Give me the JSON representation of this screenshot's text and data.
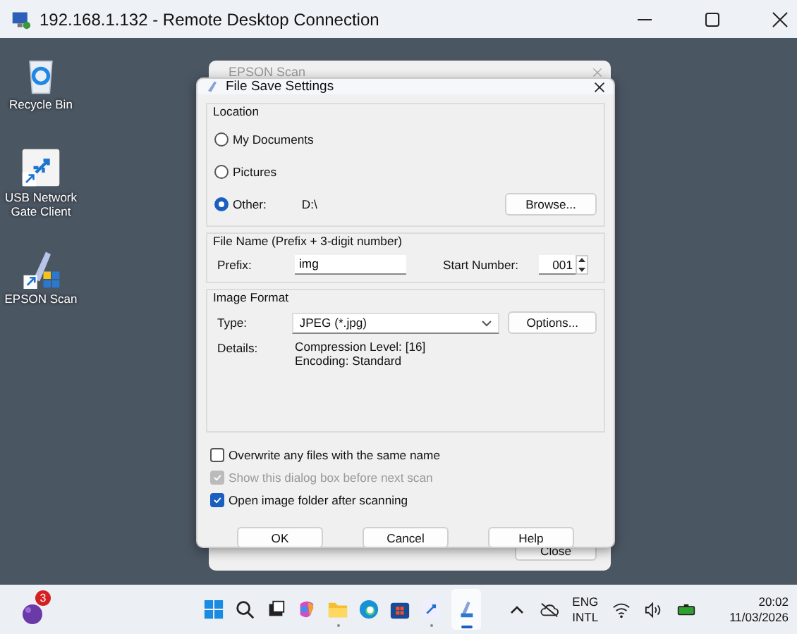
{
  "remote_window": {
    "title": "192.168.1.132 - Remote Desktop Connection"
  },
  "desktop_icons": [
    {
      "kind": "recycle",
      "label": "Recycle Bin"
    },
    {
      "kind": "usb",
      "label": "USB Network Gate Client"
    },
    {
      "kind": "scanner",
      "label": "EPSON Scan"
    }
  ],
  "background_window": {
    "title": "EPSON Scan",
    "close_button": "Close"
  },
  "dialog": {
    "title": "File Save Settings",
    "location": {
      "title": "Location",
      "options": [
        {
          "label": "My Documents",
          "selected": false
        },
        {
          "label": "Pictures",
          "selected": false
        },
        {
          "label": "Other:",
          "value": "D:\\",
          "selected": true
        }
      ],
      "browse_button": "Browse..."
    },
    "file_name": {
      "title": "File Name (Prefix + 3-digit number)",
      "prefix_label": "Prefix:",
      "prefix_value": "img",
      "start_label": "Start Number:",
      "start_value": "001"
    },
    "image_format": {
      "title": "Image Format",
      "type_label": "Type:",
      "type_value": "JPEG (*.jpg)",
      "options_button": "Options...",
      "details_label": "Details:",
      "details": [
        "Compression Level: [16]",
        "Encoding: Standard"
      ]
    },
    "checkboxes": [
      {
        "label": "Overwrite any files with the same name",
        "checked": false,
        "disabled": false
      },
      {
        "label": "Show this dialog box before next scan",
        "checked": true,
        "disabled": true
      },
      {
        "label": "Open image folder after scanning",
        "checked": true,
        "disabled": false
      }
    ],
    "buttons": [
      "OK",
      "Cancel",
      "Help"
    ]
  },
  "taskbar": {
    "widget_badge": "3",
    "language": [
      "ENG",
      "INTL"
    ],
    "time": "20:02",
    "date": "11/03/2026"
  }
}
